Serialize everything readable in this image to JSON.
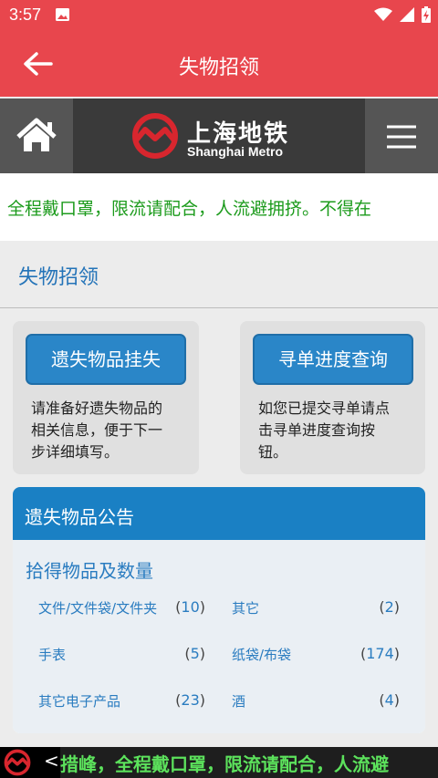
{
  "status_bar": {
    "time": "3:57"
  },
  "app_bar": {
    "title": "失物招领"
  },
  "metro": {
    "name_cn": "上海地铁",
    "name_en": "Shanghai Metro"
  },
  "marquee": {
    "text": "全程戴口罩，限流请配合，人流避拥挤。不得在"
  },
  "section": {
    "title": "失物招领"
  },
  "cards": [
    {
      "button": "遗失物品挂失",
      "lines": [
        "请准备好遗失物品的",
        "相关信息，便于下一",
        "步详细填写。"
      ]
    },
    {
      "button": "寻单进度查询",
      "lines": [
        "如您已提交寻单请点",
        "击寻单进度查询按",
        "钮。"
      ]
    }
  ],
  "notice": {
    "header": "遗失物品公告",
    "subtitle": "拾得物品及数量",
    "items": [
      {
        "name": "文件/文件袋/文件夹",
        "count": "10"
      },
      {
        "name": "其它",
        "count": "2"
      },
      {
        "name": "手表",
        "count": "5"
      },
      {
        "name": "纸袋/布袋",
        "count": "174"
      },
      {
        "name": "其它电子产品",
        "count": "23"
      },
      {
        "name": "酒",
        "count": "4"
      }
    ]
  },
  "bottom_strip": {
    "arrow": "<",
    "text": "措峰，全程戴口罩，限流请配合，人流避"
  },
  "colors": {
    "primary_red": "#e8464d",
    "blue": "#1a80c4",
    "green_text": "#1c9b1c"
  }
}
